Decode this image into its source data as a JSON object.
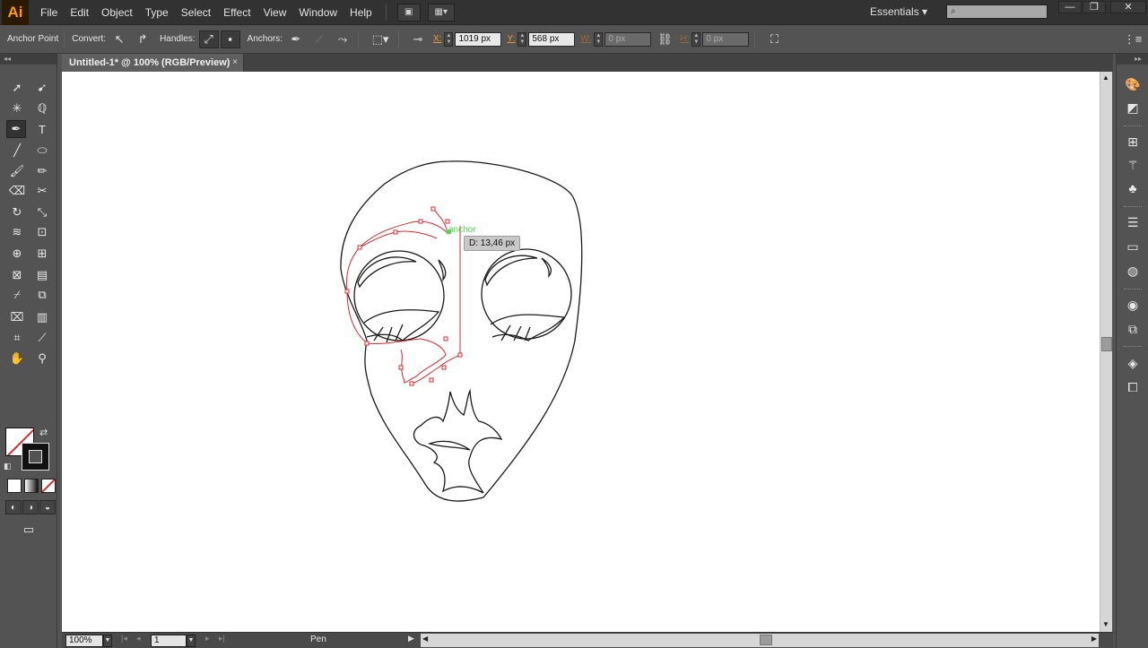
{
  "menubar": {
    "logo": "Ai",
    "items": [
      "File",
      "Edit",
      "Object",
      "Type",
      "Select",
      "Effect",
      "View",
      "Window",
      "Help"
    ],
    "workspace": "Essentials",
    "window_controls": [
      "—",
      "❐",
      "✕"
    ]
  },
  "controlbar": {
    "tool_name": "Anchor Point",
    "convert_label": "Convert:",
    "handles_label": "Handles:",
    "anchors_label": "Anchors:",
    "x_label": "X:",
    "x_value": "1019 px",
    "y_label": "Y:",
    "y_value": "568 px",
    "w_label": "W:",
    "w_value": "0 px",
    "h_label": "H:",
    "h_value": "0 px"
  },
  "document": {
    "tab_title": "Untitled-1* @ 100% (RGB/Preview)",
    "tab_close": "×",
    "distance_tooltip": "D: 13,46 px",
    "anchor_hint": "anchor"
  },
  "statusbar": {
    "zoom": "100%",
    "artboard": "1",
    "current_tool": "Pen"
  },
  "colors": {
    "accent": "#ff9a00",
    "path_selection": "#e0282f",
    "anchor_hint": "#4cd64c",
    "chrome": "#535353"
  }
}
